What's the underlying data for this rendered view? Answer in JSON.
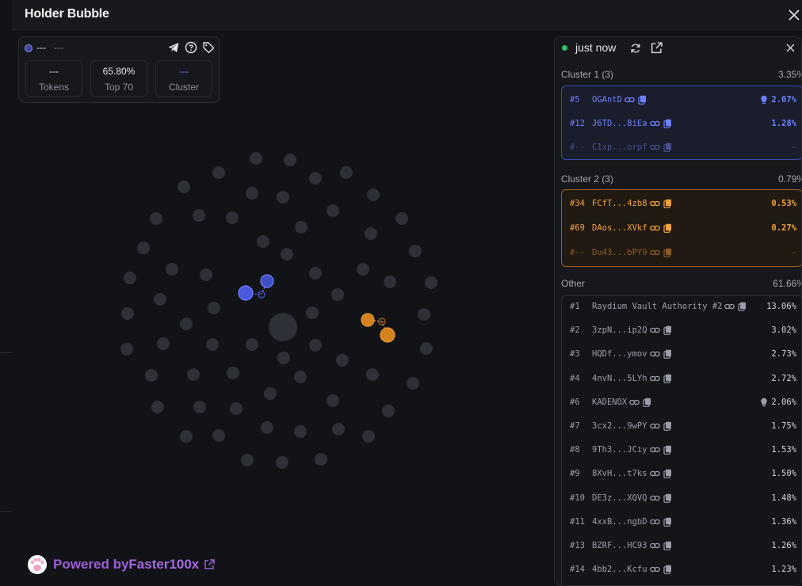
{
  "modal": {
    "title": "Holder Bubble"
  },
  "stats": {
    "name": "---",
    "name_secondary": "---",
    "boxes": [
      {
        "value": "---",
        "label": "Tokens"
      },
      {
        "value": "65.80%",
        "label": "Top 70"
      },
      {
        "value": "---",
        "label": "Cluster"
      }
    ]
  },
  "powered": {
    "prefix": "Powered by ",
    "brand": "Faster100x"
  },
  "panel": {
    "status": "just now",
    "cluster1": {
      "label": "Cluster 1 (3)",
      "pct": "3.35%",
      "rows": [
        {
          "rank": "#5",
          "addr": "OGAntD",
          "pct": "2.07%",
          "bulb": true
        },
        {
          "rank": "#12",
          "addr": "J6TD...8iEa",
          "pct": "1.28%"
        },
        {
          "rank": "#--",
          "addr": "C1xp...orpf",
          "pct": "-"
        }
      ]
    },
    "cluster2": {
      "label": "Cluster 2 (3)",
      "pct": "0.79%",
      "rows": [
        {
          "rank": "#34",
          "addr": "FCfT...4zb8",
          "pct": "0.53%"
        },
        {
          "rank": "#69",
          "addr": "DAos...XVkf",
          "pct": "0.27%"
        },
        {
          "rank": "#--",
          "addr": "Du43...bPY9",
          "pct": "-"
        }
      ]
    },
    "other": {
      "label": "Other",
      "pct": "61.66%",
      "rows": [
        {
          "rank": "#1",
          "addr": "Raydium Vault Authority #2",
          "pct": "13.06%"
        },
        {
          "rank": "#2",
          "addr": "3zpN...ip2Q",
          "pct": "3.02%"
        },
        {
          "rank": "#3",
          "addr": "HQDf...ymov",
          "pct": "2.73%"
        },
        {
          "rank": "#4",
          "addr": "4nvN...5LYh",
          "pct": "2.72%"
        },
        {
          "rank": "#6",
          "addr": "KADENOX",
          "pct": "2.06%",
          "bulb": true
        },
        {
          "rank": "#7",
          "addr": "3cx2...9wPY",
          "pct": "1.75%"
        },
        {
          "rank": "#8",
          "addr": "9Th3...JCiy",
          "pct": "1.53%"
        },
        {
          "rank": "#9",
          "addr": "8XvH...t7ks",
          "pct": "1.50%"
        },
        {
          "rank": "#10",
          "addr": "DE3z...XQVQ",
          "pct": "1.48%"
        },
        {
          "rank": "#11",
          "addr": "4xxB...ngbD",
          "pct": "1.36%"
        },
        {
          "rank": "#13",
          "addr": "BZRF...HC93",
          "pct": "1.26%"
        },
        {
          "rank": "#14",
          "addr": "4bb2...Kcfu",
          "pct": "1.23%"
        }
      ]
    }
  },
  "colors": {
    "cluster1": "#4a5ae0",
    "cluster2": "#d4821e",
    "holder": "#2e3038",
    "accent_brand": "#9b5fd6",
    "status_live": "#2fbf71"
  }
}
